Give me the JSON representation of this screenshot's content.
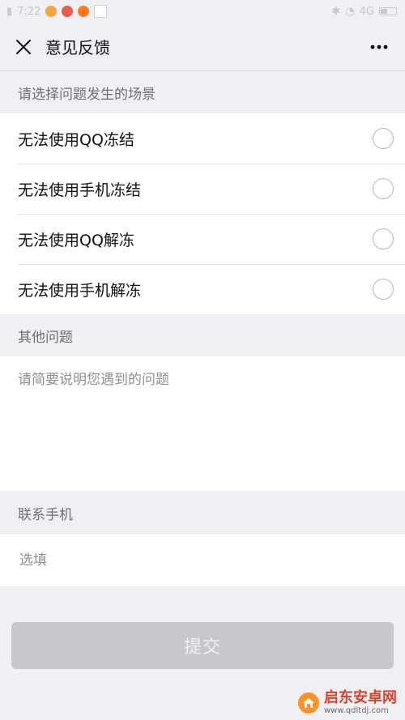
{
  "status_bar": {
    "time": "7:22",
    "network": "4G"
  },
  "header": {
    "title": "意见反馈",
    "close_icon": "close-icon",
    "more_icon": "more-icon"
  },
  "scenario_section": {
    "label": "请选择问题发生的场景",
    "options": [
      "无法使用QQ冻结",
      "无法使用手机冻结",
      "无法使用QQ解冻",
      "无法使用手机解冻"
    ]
  },
  "other_section": {
    "label": "其他问题",
    "placeholder": "请简要说明您遇到的问题"
  },
  "contact_section": {
    "label": "联系手机",
    "placeholder": "选填"
  },
  "submit": {
    "label": "提交"
  },
  "watermark": {
    "title": "启东安卓网",
    "url": "www.qdltdj.com"
  },
  "colors": {
    "background": "#efeff4",
    "submit_disabled": "#c8c8cc",
    "watermark_orange": "#ff8b1f",
    "watermark_red": "#d63a20"
  }
}
